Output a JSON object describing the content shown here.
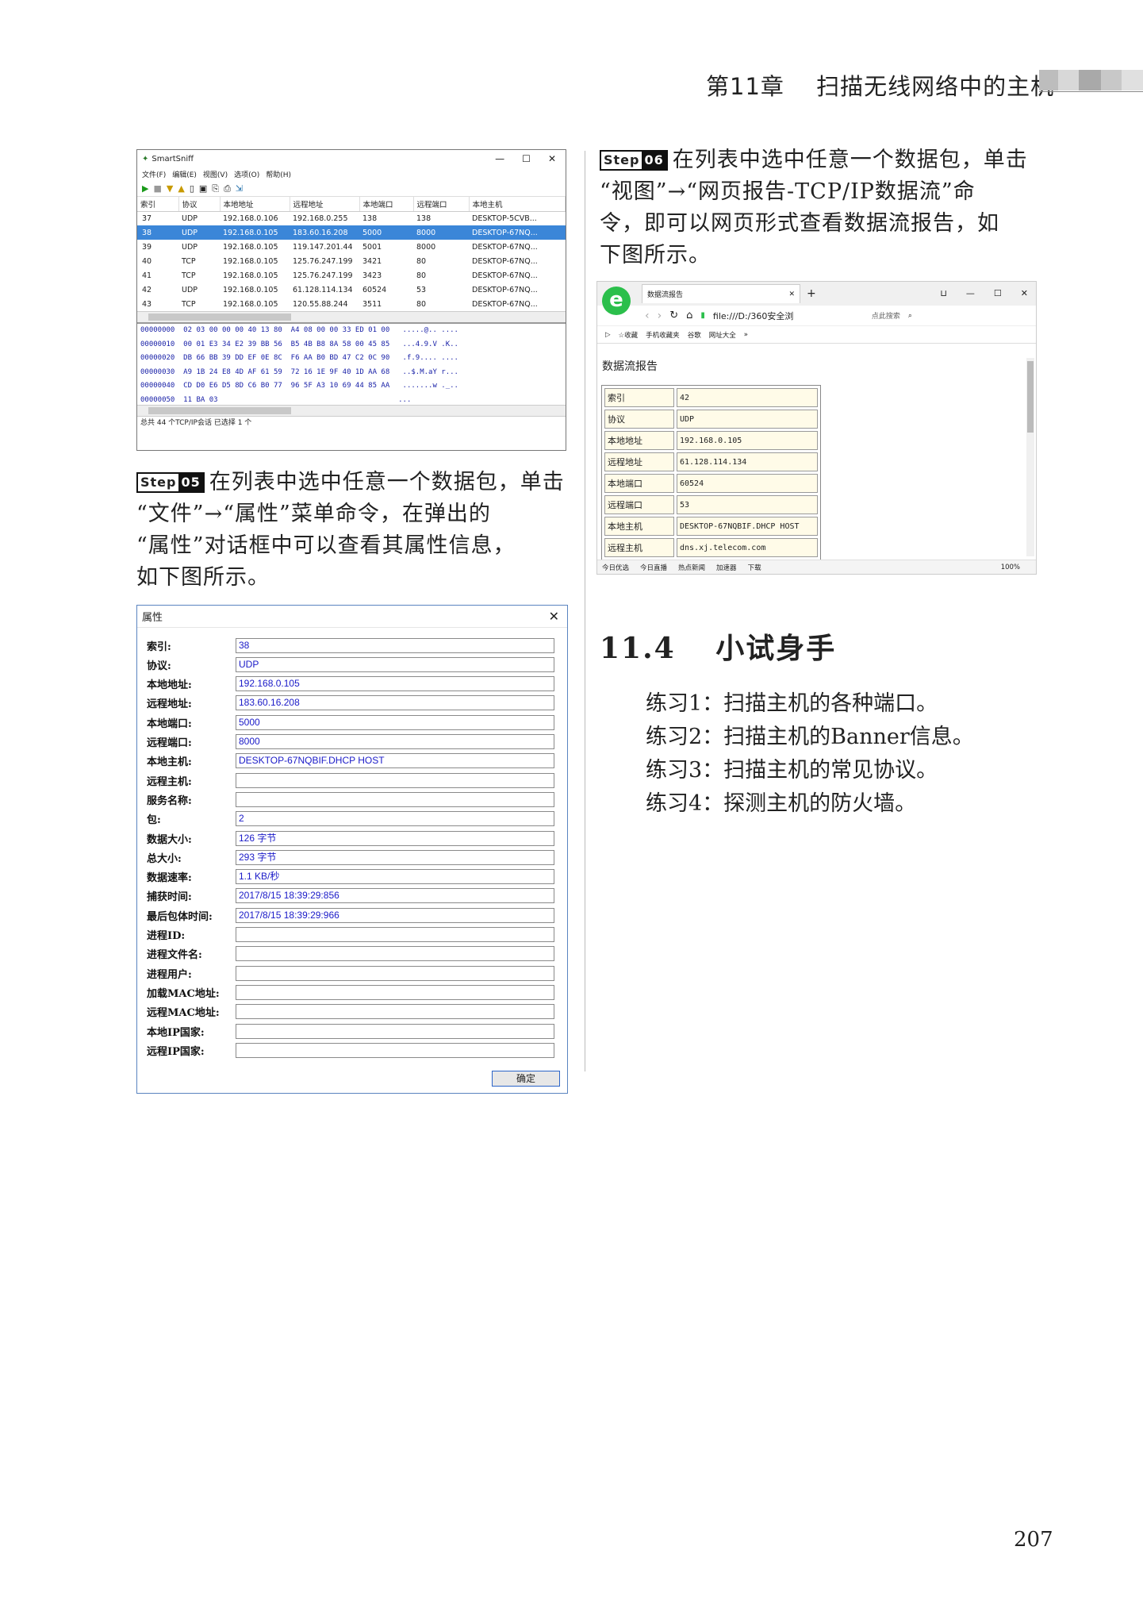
{
  "header": {
    "chapter": "第11章",
    "title": "扫描无线网络中的主机",
    "bar_colors": [
      "#bdbdbd",
      "#d8d8d8",
      "#a9a9a9",
      "#c8c8c8",
      "#e0e0e0"
    ]
  },
  "step05": {
    "badge_word": "Step",
    "badge_num": "05",
    "lines": [
      "在列表中选中任意一个数据包，单击",
      "“文件”→“属性”菜单命令，在弹出的",
      "“属性”对话框中可以查看其属性信息，",
      "如下图所示。"
    ]
  },
  "step06": {
    "badge_word": "Step",
    "badge_num": "06",
    "lines": [
      "在列表中选中任意一个数据包，单击",
      "“视图”→“网页报告-TCP/IP数据流”命",
      "令，即可以网页形式查看数据流报告，如",
      "下图所示。"
    ]
  },
  "smartsniff": {
    "title": "SmartSniff",
    "win_buttons": [
      "—",
      "☐",
      "✕"
    ],
    "menu": [
      "文件(F)",
      "编辑(E)",
      "视图(V)",
      "选项(O)",
      "帮助(H)"
    ],
    "toolbar": [
      "▶",
      "■",
      "▼",
      "▲",
      "▯",
      "▣",
      "⎘",
      "⎙",
      "⇲"
    ],
    "columns": [
      "索引",
      "协议",
      "本地地址",
      "远程地址",
      "本地端口",
      "远程端口",
      "本地主机"
    ],
    "rows": [
      [
        "37",
        "UDP",
        "192.168.0.106",
        "192.168.0.255",
        "138",
        "138",
        "DESKTOP-5CVB..."
      ],
      [
        "38",
        "UDP",
        "192.168.0.105",
        "183.60.16.208",
        "5000",
        "8000",
        "DESKTOP-67NQ..."
      ],
      [
        "39",
        "UDP",
        "192.168.0.105",
        "119.147.201.44",
        "5001",
        "8000",
        "DESKTOP-67NQ..."
      ],
      [
        "40",
        "TCP",
        "192.168.0.105",
        "125.76.247.199",
        "3421",
        "80",
        "DESKTOP-67NQ..."
      ],
      [
        "41",
        "TCP",
        "192.168.0.105",
        "125.76.247.199",
        "3423",
        "80",
        "DESKTOP-67NQ..."
      ],
      [
        "42",
        "UDP",
        "192.168.0.105",
        "61.128.114.134",
        "60524",
        "53",
        "DESKTOP-67NQ..."
      ],
      [
        "43",
        "TCP",
        "192.168.0.105",
        "120.55.88.244",
        "3511",
        "80",
        "DESKTOP-67NQ..."
      ]
    ],
    "selected_row": 1,
    "hex_lines": [
      "00000000  02 03 00 00 00 40 13 80  A4 08 00 00 33 ED 01 00   .....@.. ....",
      "00000010  00 01 E3 34 E2 39 BB 56  B5 4B B8 8A 58 00 45 85   ...4.9.V .K..",
      "00000020  DB 66 BB 39 DD EF 0E 8C  F6 AA B0 BD 47 C2 0C 90   .f.9.... ....",
      "00000030  A9 1B 24 E8 4D AF 61 59  72 16 1E 9F 40 1D AA 68   ..$.M.aY r...",
      "00000040  CD D0 E6 D5 8D C6 B0 77  96 5F A3 10 69 44 85 AA   .......w ._..",
      "00000050  11 BA 03                                          ..."
    ],
    "status": "总共 44 个TCP/IP会话  已选择 1 个"
  },
  "props": {
    "title": "属性",
    "close": "✕",
    "fields": [
      {
        "label": "索引:",
        "value": "38"
      },
      {
        "label": "协议:",
        "value": "UDP"
      },
      {
        "label": "本地地址:",
        "value": "192.168.0.105"
      },
      {
        "label": "远程地址:",
        "value": "183.60.16.208"
      },
      {
        "label": "本地端口:",
        "value": "5000"
      },
      {
        "label": "远程端口:",
        "value": "8000"
      },
      {
        "label": "本地主机:",
        "value": "DESKTOP-67NQBIF.DHCP HOST"
      },
      {
        "label": "远程主机:",
        "value": ""
      },
      {
        "label": "服务名称:",
        "value": ""
      },
      {
        "label": "包:",
        "value": "2"
      },
      {
        "label": "数据大小:",
        "value": "126 字节"
      },
      {
        "label": "总大小:",
        "value": "293 字节"
      },
      {
        "label": "数据速率:",
        "value": "1.1 KB/秒"
      },
      {
        "label": "捕获时间:",
        "value": "2017/8/15 18:39:29:856"
      },
      {
        "label": "最后包体时间:",
        "value": "2017/8/15 18:39:29:966"
      },
      {
        "label": "进程ID:",
        "value": ""
      },
      {
        "label": "进程文件名:",
        "value": ""
      },
      {
        "label": "进程用户:",
        "value": ""
      },
      {
        "label": "加载MAC地址:",
        "value": ""
      },
      {
        "label": "远程MAC地址:",
        "value": ""
      },
      {
        "label": "本地IP国家:",
        "value": ""
      },
      {
        "label": "远程IP国家:",
        "value": ""
      }
    ],
    "ok": "确定"
  },
  "browser": {
    "logo": "e",
    "tab_title": "数据流报告",
    "tab_close": "✕",
    "new_tab": "+",
    "win_buttons": [
      "⊔",
      "—",
      "☐",
      "✕"
    ],
    "nav": [
      "‹",
      "›",
      "↻",
      "⌂"
    ],
    "url": "file:///D:/360安全浏",
    "search": "点此搜索",
    "favorites": [
      "▷",
      "☆收藏",
      "手机收藏夹",
      "谷歌",
      "网址大全",
      "»"
    ],
    "page_title": "数据流报告",
    "rows": [
      {
        "k": "索引",
        "v": "42"
      },
      {
        "k": "协议",
        "v": "UDP"
      },
      {
        "k": "本地地址",
        "v": "192.168.0.105"
      },
      {
        "k": "远程地址",
        "v": "61.128.114.134"
      },
      {
        "k": "本地端口",
        "v": "60524"
      },
      {
        "k": "远程端口",
        "v": "53"
      },
      {
        "k": "本地主机",
        "v": "DESKTOP-67NQBIF.DHCP HOST"
      },
      {
        "k": "远程主机",
        "v": "dns.xj.telecom.com"
      }
    ],
    "bottom": [
      "今日优选",
      "今日直播",
      "热点新闻",
      "加速器",
      "下载",
      "100%"
    ]
  },
  "section": {
    "number": "11.4",
    "title": "小试身手",
    "exercises": [
      "练习1：扫描主机的各种端口。",
      "练习2：扫描主机的Banner信息。",
      "练习3：扫描主机的常见协议。",
      "练习4：探测主机的防火墙。"
    ]
  },
  "page_number": "207"
}
